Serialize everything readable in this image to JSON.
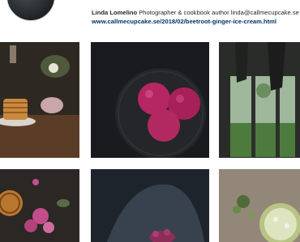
{
  "profile": {
    "name": "Linda Lomelino",
    "bio_text": "Photographer & cookbook author linda@callmecupcake.se",
    "link": "www.callmecupcake.se/2018/02/beetroot-ginger-ice-cream.html"
  },
  "posts": [
    {
      "subject": "pancake-stack-photo"
    },
    {
      "subject": "beetroot-ice-cream-photo"
    },
    {
      "subject": "window-dark-interior-photo"
    },
    {
      "subject": "pie-and-flowers-photo"
    },
    {
      "subject": "person-with-berries-photo"
    },
    {
      "subject": "lime-tart-photo"
    }
  ]
}
